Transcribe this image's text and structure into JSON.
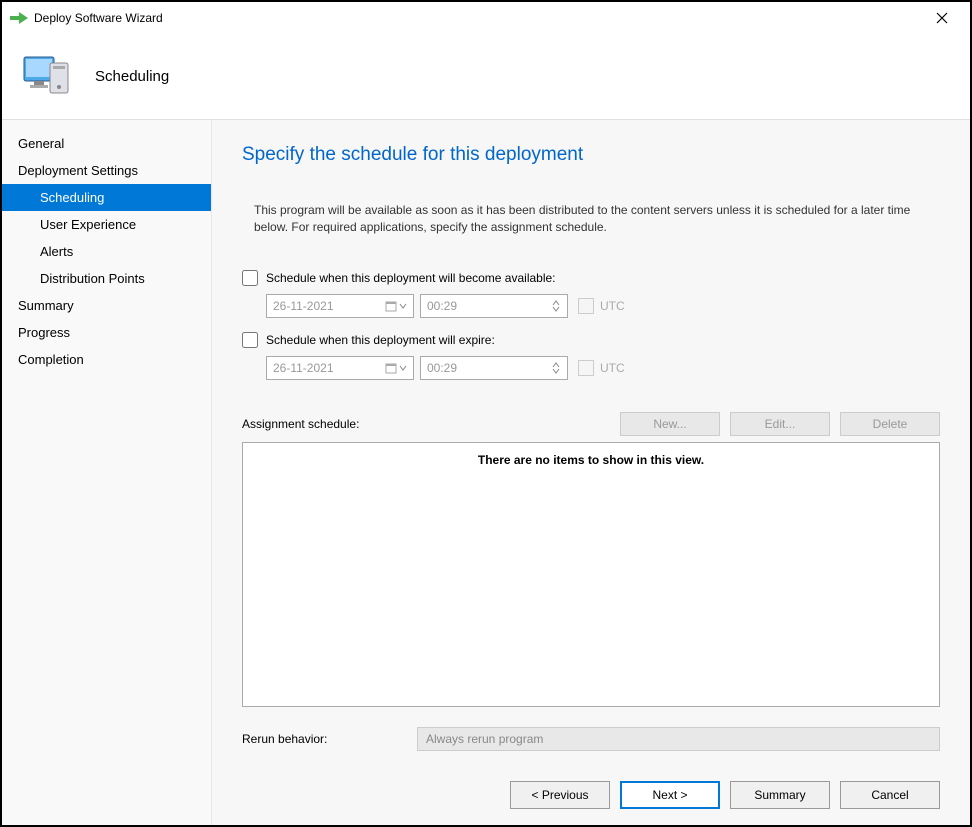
{
  "window": {
    "title": "Deploy Software Wizard"
  },
  "header": {
    "page_title": "Scheduling"
  },
  "sidebar": {
    "items": [
      {
        "label": "General",
        "sub": false,
        "selected": false
      },
      {
        "label": "Deployment Settings",
        "sub": false,
        "selected": false
      },
      {
        "label": "Scheduling",
        "sub": true,
        "selected": true
      },
      {
        "label": "User Experience",
        "sub": true,
        "selected": false
      },
      {
        "label": "Alerts",
        "sub": true,
        "selected": false
      },
      {
        "label": "Distribution Points",
        "sub": true,
        "selected": false
      },
      {
        "label": "Summary",
        "sub": false,
        "selected": false
      },
      {
        "label": "Progress",
        "sub": false,
        "selected": false
      },
      {
        "label": "Completion",
        "sub": false,
        "selected": false
      }
    ]
  },
  "main": {
    "heading": "Specify the schedule for this deployment",
    "description": "This program will be available as soon as it has been distributed to the content servers unless it is scheduled for a later time below. For required applications, specify the assignment schedule.",
    "available_checkbox_label": "Schedule when this deployment will become available:",
    "available_date": "26-11-2021",
    "available_time": "00:29",
    "utc_label": "UTC",
    "expire_checkbox_label": "Schedule when this deployment will expire:",
    "expire_date": "26-11-2021",
    "expire_time": "00:29",
    "assignment_label": "Assignment schedule:",
    "new_button": "New...",
    "edit_button": "Edit...",
    "delete_button": "Delete",
    "empty_list_text": "There are no items to show in this view.",
    "rerun_label": "Rerun behavior:",
    "rerun_value": "Always rerun program"
  },
  "footer": {
    "previous": "< Previous",
    "next": "Next >",
    "summary": "Summary",
    "cancel": "Cancel"
  }
}
